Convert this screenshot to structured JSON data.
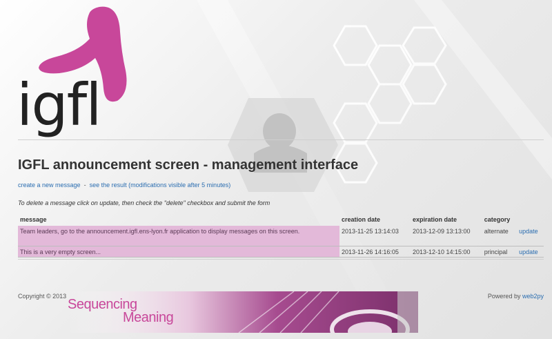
{
  "logo": {
    "text": "igfl",
    "accent": "#c8479a"
  },
  "page": {
    "title": "IGFL announcement screen - management interface",
    "links": {
      "new_message": "create a new message",
      "separator": "-",
      "see_result": "see the result",
      "see_result_note": "(modifications visible after 5 minutes)"
    },
    "instruction": "To delete a message click on update, then check the \"delete\" checkbox and submit the form"
  },
  "table": {
    "headers": {
      "message": "message",
      "creation": "creation date",
      "expiration": "expiration date",
      "category": "category"
    },
    "rows": [
      {
        "message": "Team leaders, go to the announcement.igfl.ens-lyon.fr application to display messages on this screen.",
        "creation": "2013-11-25 13:14:03",
        "expiration": "2013-12-09 13:13:00",
        "category": "alternate",
        "action": "update"
      },
      {
        "message": "This is a very empty screen...",
        "creation": "2013-11-26 14:16:05",
        "expiration": "2013-12-10 14:15:00",
        "category": "principal",
        "action": "update"
      }
    ]
  },
  "footer": {
    "copyright": "Copyright © 2013",
    "powered_prefix": "Powered by",
    "powered_link": "web2py",
    "banner_line1": "Sequencing",
    "banner_line2": "Meaning"
  }
}
